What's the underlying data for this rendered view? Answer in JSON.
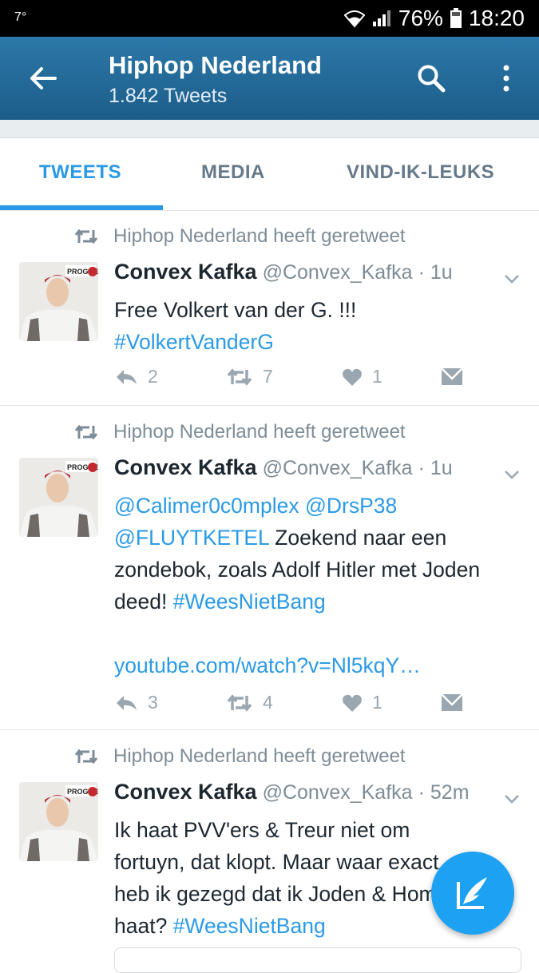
{
  "status_bar": {
    "temperature": "7°",
    "battery": "76%",
    "time": "18:20"
  },
  "header": {
    "title": "Hiphop Nederland",
    "subtitle": "1.842 Tweets"
  },
  "tabs": [
    {
      "label": "TWEETS",
      "active": true
    },
    {
      "label": "MEDIA",
      "active": false
    },
    {
      "label": "VIND-IK-LEUKS",
      "active": false
    }
  ],
  "tweets": [
    {
      "retweet_label": "Hiphop Nederland heeft geretweet",
      "name": "Convex Kafka",
      "handle": "@Convex_Kafka",
      "separator": "·",
      "time": "1u",
      "text_1": "Free Volkert van der G. !!!",
      "hashtag_1": "#VolkertVanderG",
      "replies": "2",
      "retweets": "7",
      "likes": "1"
    },
    {
      "retweet_label": "Hiphop Nederland heeft geretweet",
      "name": "Convex Kafka",
      "handle": "@Convex_Kafka",
      "separator": "·",
      "time": "1u",
      "mention_1": "@Calimer0c0mplex",
      "mention_2": "@DrsP38",
      "mention_3": "@FLUYTKETEL",
      "text_1": " Zoekend naar een zondebok, zoals Adolf Hitler met Joden deed! ",
      "hashtag_1": "#WeesNietBang",
      "link": "youtube.com/watch?v=Nl5kqY…",
      "replies": "3",
      "retweets": "4",
      "likes": "1"
    },
    {
      "retweet_label": "Hiphop Nederland heeft geretweet",
      "name": "Convex Kafka",
      "handle": "@Convex_Kafka",
      "separator": "·",
      "time": "52m",
      "text_1": "Ik haat PVV'ers & Treur niet om fortuyn, dat klopt. Maar waar exact heb ik gezegd dat ik Joden & Homo's haat? ",
      "hashtag_1": "#WeesNietBang"
    }
  ],
  "colors": {
    "accent": "#2a9ae6",
    "header_bg": "#1f6593",
    "fab": "#1da1f2"
  },
  "icons": [
    "back-arrow-icon",
    "search-icon",
    "overflow-menu-icon",
    "retweet-icon",
    "reply-icon",
    "heart-icon",
    "direct-message-icon",
    "chevron-down-icon",
    "compose-icon"
  ]
}
